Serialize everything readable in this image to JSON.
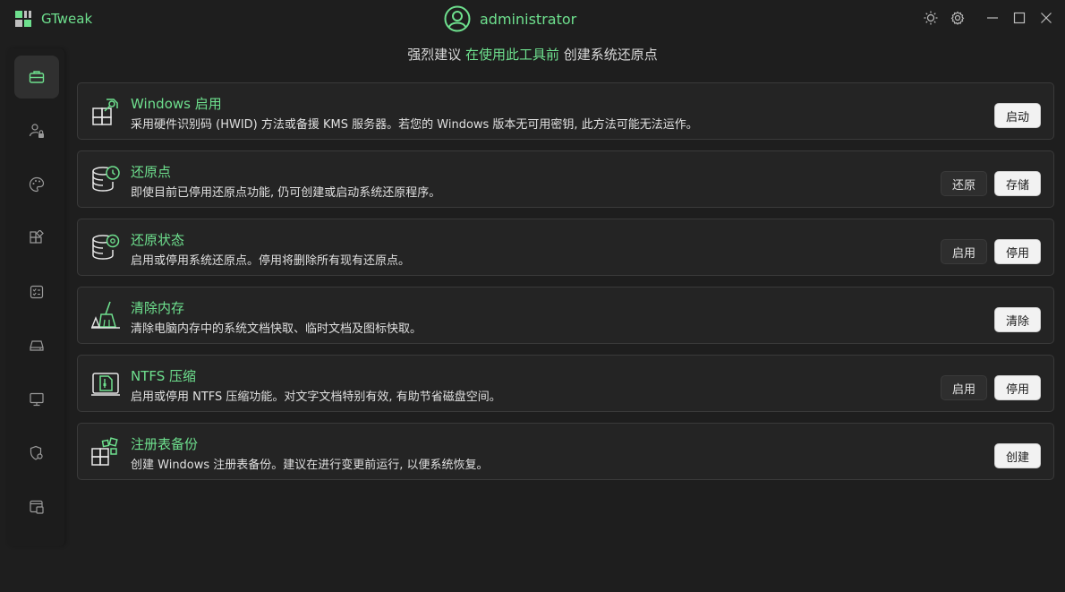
{
  "app": {
    "title": "GTweak",
    "user": "administrator"
  },
  "banner": {
    "prefix": "强烈建议",
    "highlight": "在使用此工具前",
    "suffix": "创建系统还原点"
  },
  "sidebar": {
    "items": [
      {
        "name": "toolbox",
        "icon": "toolbox-icon",
        "active": true
      },
      {
        "name": "user",
        "icon": "user-lock-icon"
      },
      {
        "name": "appearance",
        "icon": "palette-icon"
      },
      {
        "name": "apps",
        "icon": "apps-icon"
      },
      {
        "name": "services",
        "icon": "checklist-icon"
      },
      {
        "name": "storage",
        "icon": "drive-icon"
      },
      {
        "name": "system",
        "icon": "monitor-icon"
      },
      {
        "name": "security",
        "icon": "shield-gear-icon"
      },
      {
        "name": "info",
        "icon": "window-info-icon"
      }
    ]
  },
  "cards": [
    {
      "title": "Windows 启用",
      "desc": "采用硬件识别码 (HWID) 方法或备援 KMS 服务器。若您的 Windows 版本无可用密钥, 此方法可能无法运作。",
      "icon": "windows-activation-icon",
      "buttons": {
        "primary": "启动"
      }
    },
    {
      "title": "还原点",
      "desc": "即使目前已停用还原点功能, 仍可创建或启动系统还原程序。",
      "icon": "restore-point-icon",
      "buttons": {
        "secondary": "还原",
        "primary": "存储"
      }
    },
    {
      "title": "还原状态",
      "desc": "启用或停用系统还原点。停用将删除所有现有还原点。",
      "icon": "database-gear-icon",
      "buttons": {
        "secondary": "启用",
        "primary": "停用"
      }
    },
    {
      "title": "清除内存",
      "desc": "清除电脑内存中的系统文档快取、临时文档及图标快取。",
      "icon": "broom-icon",
      "buttons": {
        "primary": "清除"
      }
    },
    {
      "title": "NTFS 压缩",
      "desc": "启用或停用 NTFS 压缩功能。对文字文档特别有效, 有助节省磁盘空间。",
      "icon": "compression-icon",
      "buttons": {
        "secondary": "启用",
        "primary": "停用"
      }
    },
    {
      "title": "注册表备份",
      "desc": "创建 Windows 注册表备份。建议在进行变更前运行, 以便系统恢复。",
      "icon": "registry-icon",
      "buttons": {
        "primary": "创建"
      }
    }
  ],
  "colors": {
    "accent": "#6ee08e",
    "background": "#1e1e1e",
    "card": "#242424"
  }
}
